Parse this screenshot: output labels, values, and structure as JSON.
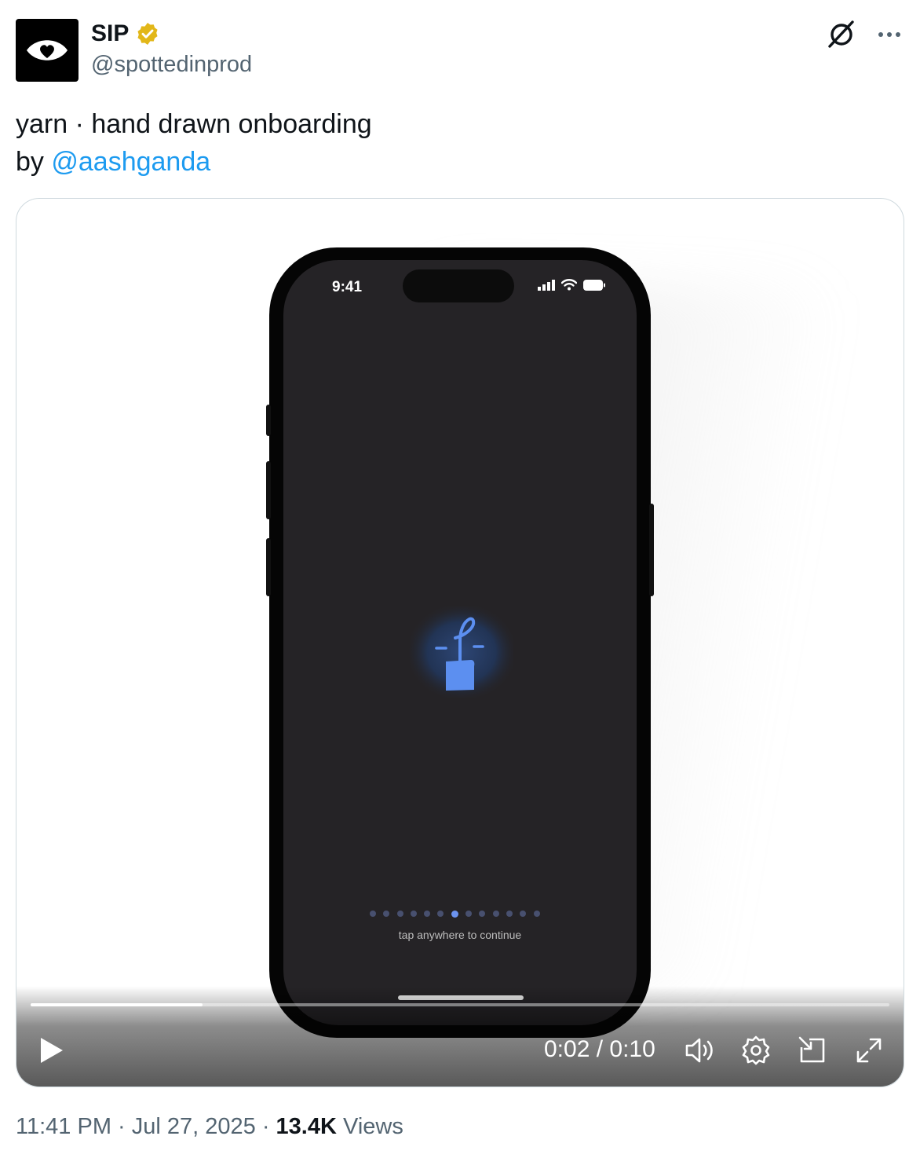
{
  "author": {
    "name": "SIP",
    "handle": "@spottedinprod"
  },
  "post": {
    "line1": "yarn · hand drawn onboarding",
    "by_prefix": "by ",
    "mention": "@aashganda"
  },
  "phone_screen": {
    "status_time": "9:41",
    "caption": "tap anywhere to continue",
    "dots_total": 13,
    "active_dot_index": 6
  },
  "video": {
    "time_display": "0:02 / 0:10",
    "progress_fraction": 0.2
  },
  "footer": {
    "timestamp": "11:41 PM · Jul 27, 2025 · ",
    "views_count": "13.4K",
    "views_label": " Views"
  },
  "colors": {
    "link": "#1d9bf0",
    "verified": "#e2b719",
    "accent_dot": "#6c93ef"
  },
  "icons": [
    "eye-heart-logo-icon",
    "verified-badge-icon",
    "grok-icon",
    "more-icon",
    "play-icon",
    "volume-icon",
    "settings-icon",
    "pip-icon",
    "fullscreen-icon"
  ]
}
